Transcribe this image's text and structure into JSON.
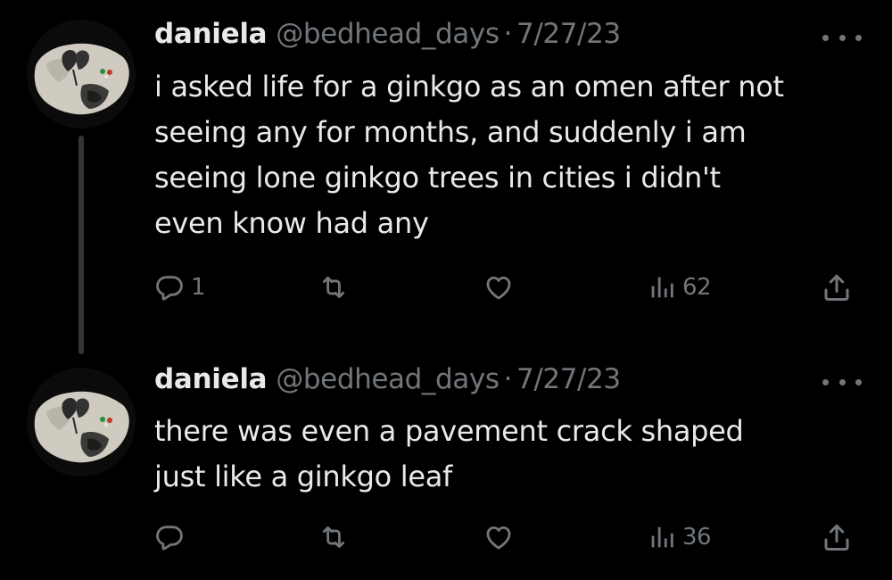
{
  "thread": [
    {
      "author_name": "daniela",
      "handle": "@bedhead_days",
      "separator": "·",
      "date": "7/27/23",
      "text": "i asked life for a ginkgo as an omen after not\nseeing any for months, and suddenly i am\nseeing lone ginkgo trees in cities i didn't\neven know had any",
      "reply_count": "1",
      "views_count": "62",
      "icons": [
        "more-options-icon",
        "reply-icon",
        "retweet-icon",
        "like-icon",
        "views-icon",
        "share-icon"
      ]
    },
    {
      "author_name": "daniela",
      "handle": "@bedhead_days",
      "separator": "·",
      "date": "7/27/23",
      "text": "there was even a pavement crack shaped\njust like a ginkgo leaf",
      "reply_count": "",
      "views_count": "36",
      "icons": [
        "more-options-icon",
        "reply-icon",
        "retweet-icon",
        "like-icon",
        "views-icon",
        "share-icon"
      ]
    }
  ],
  "colors": {
    "background": "#000000",
    "primary_text": "#e7e9ea",
    "secondary_text": "#71767b",
    "thread_line": "#333639"
  }
}
